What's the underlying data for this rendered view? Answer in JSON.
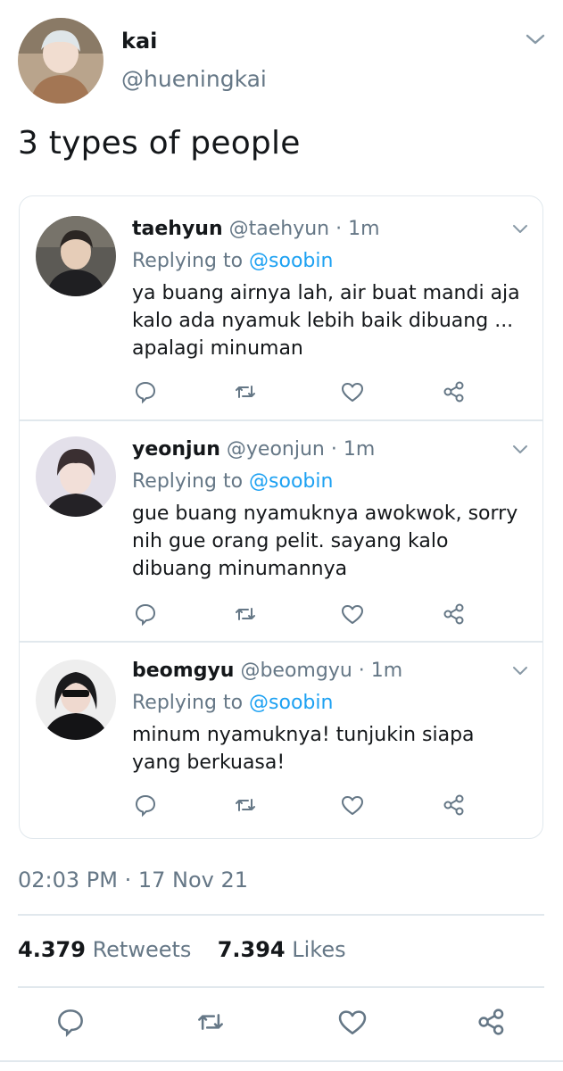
{
  "tweet": {
    "author": {
      "name": "kai",
      "handle": "@hueningkai"
    },
    "text": "3 types of people",
    "timestamp": "02:03 PM · 17 Nov 21",
    "stats": {
      "retweets": "4.379",
      "retweets_label": "Retweets",
      "likes": "7.394",
      "likes_label": "Likes"
    }
  },
  "replies": [
    {
      "name": "taehyun",
      "handle": "@taehyun",
      "time": "· 1m",
      "replying_label": "Replying to",
      "mention": "@soobin",
      "text": "ya buang airnya lah, air buat mandi aja kalo ada nyamuk lebih baik dibuang ... apalagi minuman"
    },
    {
      "name": "yeonjun",
      "handle": "@yeonjun",
      "time": "· 1m",
      "replying_label": "Replying to",
      "mention": "@soobin",
      "text": "gue buang nyamuknya awokwok, sorry nih gue orang pelit. sayang kalo dibuang minumannya"
    },
    {
      "name": "beomgyu",
      "handle": "@beomgyu",
      "time": "· 1m",
      "replying_label": "Replying to",
      "mention": "@soobin",
      "text": "minum nyamuknya! tunjukin siapa yang berkuasa!"
    }
  ],
  "icons": {
    "reply": "reply-icon",
    "retweet": "retweet-icon",
    "like": "heart-icon",
    "share": "share-icon",
    "more": "chevron-down-icon"
  },
  "colors": {
    "text": "#14171a",
    "muted": "#657786",
    "link": "#1da1f2",
    "border": "#e1e8ed"
  }
}
